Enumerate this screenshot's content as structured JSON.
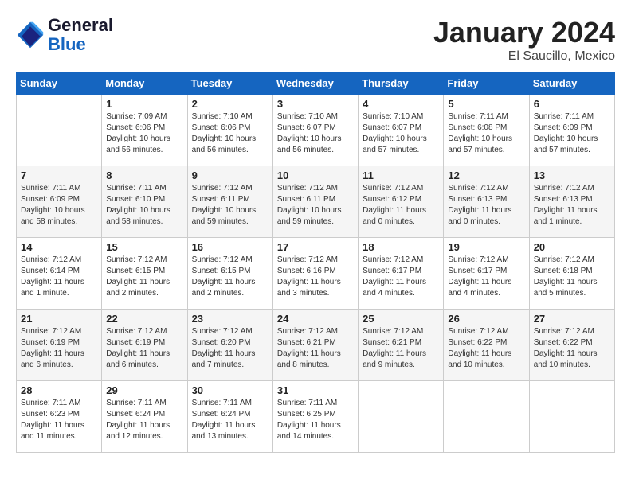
{
  "header": {
    "logo_line1": "General",
    "logo_line2": "Blue",
    "month": "January 2024",
    "location": "El Saucillo, Mexico"
  },
  "weekdays": [
    "Sunday",
    "Monday",
    "Tuesday",
    "Wednesday",
    "Thursday",
    "Friday",
    "Saturday"
  ],
  "weeks": [
    [
      {
        "day": "",
        "info": ""
      },
      {
        "day": "1",
        "info": "Sunrise: 7:09 AM\nSunset: 6:06 PM\nDaylight: 10 hours\nand 56 minutes."
      },
      {
        "day": "2",
        "info": "Sunrise: 7:10 AM\nSunset: 6:06 PM\nDaylight: 10 hours\nand 56 minutes."
      },
      {
        "day": "3",
        "info": "Sunrise: 7:10 AM\nSunset: 6:07 PM\nDaylight: 10 hours\nand 56 minutes."
      },
      {
        "day": "4",
        "info": "Sunrise: 7:10 AM\nSunset: 6:07 PM\nDaylight: 10 hours\nand 57 minutes."
      },
      {
        "day": "5",
        "info": "Sunrise: 7:11 AM\nSunset: 6:08 PM\nDaylight: 10 hours\nand 57 minutes."
      },
      {
        "day": "6",
        "info": "Sunrise: 7:11 AM\nSunset: 6:09 PM\nDaylight: 10 hours\nand 57 minutes."
      }
    ],
    [
      {
        "day": "7",
        "info": "Sunrise: 7:11 AM\nSunset: 6:09 PM\nDaylight: 10 hours\nand 58 minutes."
      },
      {
        "day": "8",
        "info": "Sunrise: 7:11 AM\nSunset: 6:10 PM\nDaylight: 10 hours\nand 58 minutes."
      },
      {
        "day": "9",
        "info": "Sunrise: 7:12 AM\nSunset: 6:11 PM\nDaylight: 10 hours\nand 59 minutes."
      },
      {
        "day": "10",
        "info": "Sunrise: 7:12 AM\nSunset: 6:11 PM\nDaylight: 10 hours\nand 59 minutes."
      },
      {
        "day": "11",
        "info": "Sunrise: 7:12 AM\nSunset: 6:12 PM\nDaylight: 11 hours\nand 0 minutes."
      },
      {
        "day": "12",
        "info": "Sunrise: 7:12 AM\nSunset: 6:13 PM\nDaylight: 11 hours\nand 0 minutes."
      },
      {
        "day": "13",
        "info": "Sunrise: 7:12 AM\nSunset: 6:13 PM\nDaylight: 11 hours\nand 1 minute."
      }
    ],
    [
      {
        "day": "14",
        "info": "Sunrise: 7:12 AM\nSunset: 6:14 PM\nDaylight: 11 hours\nand 1 minute."
      },
      {
        "day": "15",
        "info": "Sunrise: 7:12 AM\nSunset: 6:15 PM\nDaylight: 11 hours\nand 2 minutes."
      },
      {
        "day": "16",
        "info": "Sunrise: 7:12 AM\nSunset: 6:15 PM\nDaylight: 11 hours\nand 2 minutes."
      },
      {
        "day": "17",
        "info": "Sunrise: 7:12 AM\nSunset: 6:16 PM\nDaylight: 11 hours\nand 3 minutes."
      },
      {
        "day": "18",
        "info": "Sunrise: 7:12 AM\nSunset: 6:17 PM\nDaylight: 11 hours\nand 4 minutes."
      },
      {
        "day": "19",
        "info": "Sunrise: 7:12 AM\nSunset: 6:17 PM\nDaylight: 11 hours\nand 4 minutes."
      },
      {
        "day": "20",
        "info": "Sunrise: 7:12 AM\nSunset: 6:18 PM\nDaylight: 11 hours\nand 5 minutes."
      }
    ],
    [
      {
        "day": "21",
        "info": "Sunrise: 7:12 AM\nSunset: 6:19 PM\nDaylight: 11 hours\nand 6 minutes."
      },
      {
        "day": "22",
        "info": "Sunrise: 7:12 AM\nSunset: 6:19 PM\nDaylight: 11 hours\nand 6 minutes."
      },
      {
        "day": "23",
        "info": "Sunrise: 7:12 AM\nSunset: 6:20 PM\nDaylight: 11 hours\nand 7 minutes."
      },
      {
        "day": "24",
        "info": "Sunrise: 7:12 AM\nSunset: 6:21 PM\nDaylight: 11 hours\nand 8 minutes."
      },
      {
        "day": "25",
        "info": "Sunrise: 7:12 AM\nSunset: 6:21 PM\nDaylight: 11 hours\nand 9 minutes."
      },
      {
        "day": "26",
        "info": "Sunrise: 7:12 AM\nSunset: 6:22 PM\nDaylight: 11 hours\nand 10 minutes."
      },
      {
        "day": "27",
        "info": "Sunrise: 7:12 AM\nSunset: 6:22 PM\nDaylight: 11 hours\nand 10 minutes."
      }
    ],
    [
      {
        "day": "28",
        "info": "Sunrise: 7:11 AM\nSunset: 6:23 PM\nDaylight: 11 hours\nand 11 minutes."
      },
      {
        "day": "29",
        "info": "Sunrise: 7:11 AM\nSunset: 6:24 PM\nDaylight: 11 hours\nand 12 minutes."
      },
      {
        "day": "30",
        "info": "Sunrise: 7:11 AM\nSunset: 6:24 PM\nDaylight: 11 hours\nand 13 minutes."
      },
      {
        "day": "31",
        "info": "Sunrise: 7:11 AM\nSunset: 6:25 PM\nDaylight: 11 hours\nand 14 minutes."
      },
      {
        "day": "",
        "info": ""
      },
      {
        "day": "",
        "info": ""
      },
      {
        "day": "",
        "info": ""
      }
    ]
  ]
}
